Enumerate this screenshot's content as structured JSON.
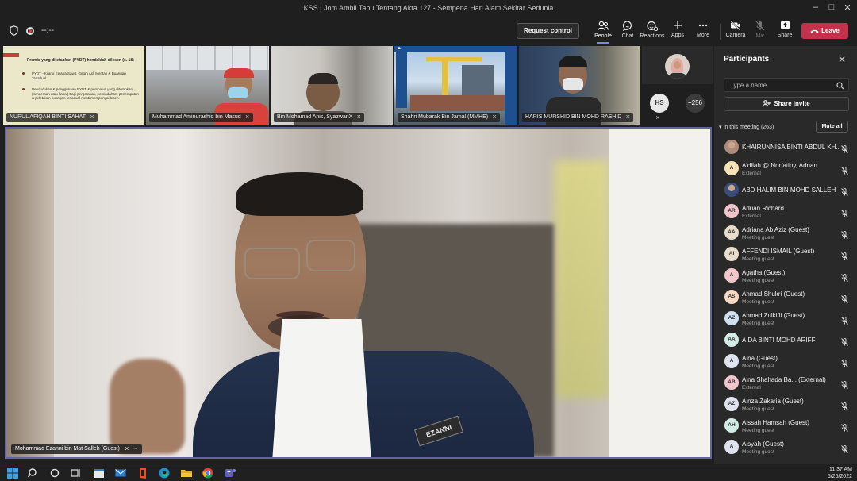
{
  "window": {
    "title": "KSS | Jom Ambil Tahu Tentang Akta 127 - Sempena Hari Alam Sekitar Sedunia"
  },
  "topbar": {
    "timer": "--:--",
    "request_control": "Request control",
    "buttons": {
      "people": "People",
      "chat": "Chat",
      "reactions": "Reactions",
      "apps": "Apps",
      "more": "More",
      "camera": "Camera",
      "mic": "Mic",
      "share": "Share"
    },
    "leave": "Leave"
  },
  "video_strip": {
    "tiles": [
      {
        "name": "NURUL AFIQAH BINTI SAHAT"
      },
      {
        "name": "Muhammad Aminurashid bin Masud"
      },
      {
        "name": "Bin Mohamad Anis, SyazwanX"
      },
      {
        "name": "Shahri Mubarak Bin Jamal (MMHE)"
      },
      {
        "name": "HARIS MURSHID BIN MOHD RASHID"
      }
    ],
    "slide": {
      "heading": "Premis yang ditetapkan (PYDT) hendaklah dilesen (s. 18)",
      "bullet1": "PYDT - Kilang Kelapa Sawit, Getah Asli Mentah & Buangan Terjadual",
      "bullet2": "Pendudukan & penggunaan PYDT & pembawa yang ditetapkan (kenderaan atau kapal) bagi pergerakan, pemindahan, penempatan & peletakan buangan terjadual mesti mempunyai lesen"
    },
    "overflow_avatar": "HS",
    "overflow_count": "+256"
  },
  "main_video": {
    "speaker": "Mohammad Ezanni bin Mat Salleh (Guest)",
    "badge_text": "EZANNI"
  },
  "participants_panel": {
    "title": "Participants",
    "search_placeholder": "Type a name",
    "share_invite": "Share invite",
    "in_meeting": "In this meeting (263)",
    "mute_all": "Mute all",
    "people": [
      {
        "name": "KHAIRUNNISA BINTI ABDUL KH...",
        "sub": "",
        "initials": "",
        "color": "#b08a7a",
        "photo": true
      },
      {
        "name": "A'dilah @ Norfatiny, Adnan",
        "sub": "External",
        "initials": "A",
        "color": "#f6e2b4"
      },
      {
        "name": "ABD HALIM BIN MOHD SALLEH",
        "sub": "",
        "initials": "",
        "color": "#3a4d7a",
        "photo": true
      },
      {
        "name": "Adrian Richard",
        "sub": "External",
        "initials": "AR",
        "color": "#f3c6cb"
      },
      {
        "name": "Adriana Ab Aziz (Guest)",
        "sub": "Meeting guest",
        "initials": "AA",
        "color": "#e8dccb"
      },
      {
        "name": "AFFENDI ISMAIL (Guest)",
        "sub": "Meeting guest",
        "initials": "AI",
        "color": "#e8dccb"
      },
      {
        "name": "Agatha (Guest)",
        "sub": "Meeting guest",
        "initials": "A",
        "color": "#f3c6cb"
      },
      {
        "name": "Ahmad Shukri (Guest)",
        "sub": "Meeting guest",
        "initials": "AS",
        "color": "#f7d9c4"
      },
      {
        "name": "Ahmad Zulkifli (Guest)",
        "sub": "Meeting guest",
        "initials": "AZ",
        "color": "#cfe0f0"
      },
      {
        "name": "AIDA BINTI MOHD ARIFF",
        "sub": "",
        "initials": "AA",
        "color": "#d4ece6"
      },
      {
        "name": "Aina (Guest)",
        "sub": "Meeting guest",
        "initials": "A",
        "color": "#dde3ef"
      },
      {
        "name": "Aina Shahada Ba... (External)",
        "sub": "External",
        "initials": "AB",
        "color": "#f3c6cb"
      },
      {
        "name": "Ainza Zakaria (Guest)",
        "sub": "Meeting guest",
        "initials": "AZ",
        "color": "#dde3ef"
      },
      {
        "name": "Aissah Hamsah (Guest)",
        "sub": "Meeting guest",
        "initials": "AH",
        "color": "#d4ece6"
      },
      {
        "name": "Aisyah (Guest)",
        "sub": "Meeting guest",
        "initials": "A",
        "color": "#dde3ef"
      }
    ]
  },
  "taskbar": {
    "time": "11:37 AM",
    "date": "5/25/2022"
  },
  "colors": {
    "accent": "#6264a7",
    "leave": "#c4314b"
  }
}
